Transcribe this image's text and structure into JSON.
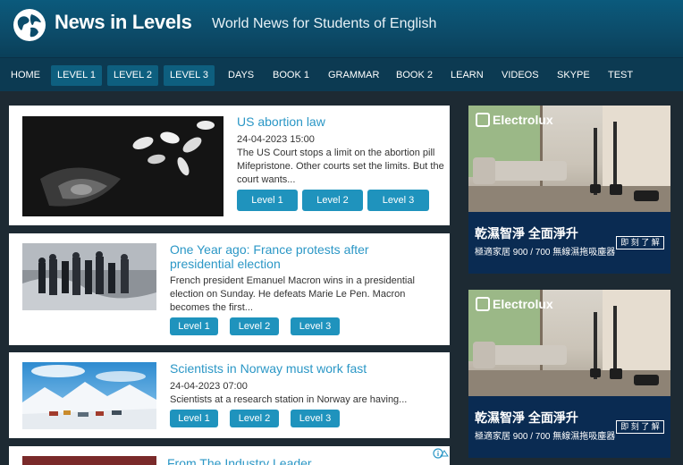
{
  "header": {
    "brand": "News in Levels",
    "tagline": "World News for Students of English"
  },
  "nav": {
    "items": [
      {
        "label": "HOME"
      },
      {
        "label": "LEVEL 1"
      },
      {
        "label": "LEVEL 2"
      },
      {
        "label": "LEVEL 3"
      },
      {
        "label": "DAYS"
      },
      {
        "label": "BOOK 1"
      },
      {
        "label": "GRAMMAR"
      },
      {
        "label": "BOOK 2"
      },
      {
        "label": "LEARN"
      },
      {
        "label": "VIDEOS"
      },
      {
        "label": "SKYPE"
      },
      {
        "label": "TEST"
      }
    ]
  },
  "articles": [
    {
      "title": "US abortion law",
      "date": "24-04-2023 15:00",
      "excerpt": "The US Court stops a limit on the abortion pill Mifepristone. Other courts set the limits. But the court wants...",
      "levels": [
        "Level 1",
        "Level 2",
        "Level 3"
      ]
    },
    {
      "title": "One Year ago: France protests after presidential election",
      "excerpt": "French president Emanuel Macron wins in a presidential election on Sunday. He defeats Marie Le Pen. Macron becomes the first...",
      "levels": [
        "Level 1",
        "Level 2",
        "Level 3"
      ]
    },
    {
      "title": "Scientists in Norway must work fast",
      "date": "24-04-2023 07:00",
      "excerpt": "Scientists at a research station in Norway are having...",
      "levels": [
        "Level 1",
        "Level 2",
        "Level 3"
      ]
    }
  ],
  "promo": {
    "title": "From The Industry Leader"
  },
  "ads": [
    {
      "brand": "Electrolux",
      "headline": "乾濕智淨 全面淨升",
      "subline": "極適家居 900 / 700 無線濕拖吸塵器",
      "button": "即 刻 了 解"
    },
    {
      "brand": "Electrolux",
      "headline": "乾濕智淨 全面淨升",
      "subline": "極適家居 900 / 700 無線濕拖吸塵器",
      "button": "即 刻 了 解"
    }
  ]
}
